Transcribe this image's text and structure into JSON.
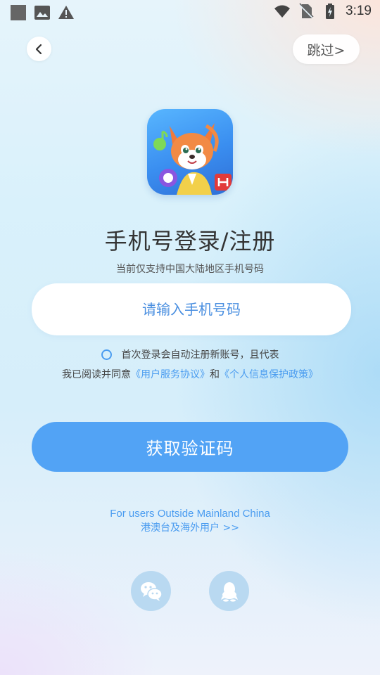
{
  "status_bar": {
    "time": "3:19",
    "left_icons": [
      "square-icon",
      "image-icon",
      "warning-icon"
    ],
    "right_icons": [
      "wifi-icon",
      "no-sim-icon",
      "battery-icon"
    ]
  },
  "nav": {
    "back_icon": "chevron-left-icon",
    "skip_label": "跳过>"
  },
  "header": {
    "title": "手机号登录/注册",
    "subtitle": "当前仅支持中国大陆地区手机号码"
  },
  "phone_input": {
    "placeholder": "请输入手机号码",
    "value": ""
  },
  "agreement": {
    "checked": false,
    "line1": "首次登录会自动注册新账号，且代表",
    "line2_prefix": "我已阅读并同意",
    "user_agreement": "《用户服务协议》",
    "and": "和",
    "privacy_policy": "《个人信息保护政策》"
  },
  "get_code_button": "获取验证码",
  "overseas": {
    "english": "For users Outside Mainland China",
    "chinese": "港澳台及海外用户 >>"
  },
  "social_login": [
    "wechat-icon",
    "qq-icon"
  ],
  "colors": {
    "accent": "#52a3f5",
    "link": "#4a9cf0",
    "social_bg": "#b9d9f1"
  }
}
